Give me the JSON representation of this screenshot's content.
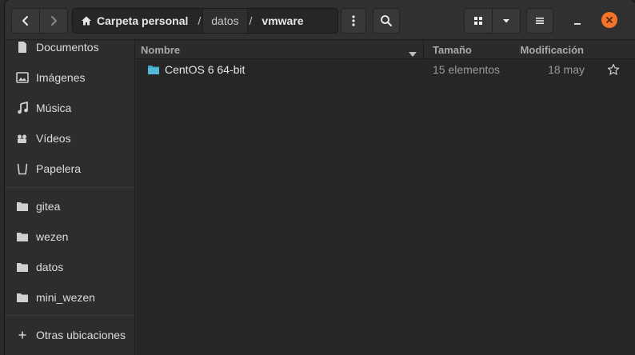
{
  "pathbar": {
    "crumbs": [
      "Carpeta personal",
      "datos",
      "vmware"
    ],
    "separator": "/"
  },
  "sidebar": {
    "places": [
      {
        "label": "Documentos",
        "icon": "document-icon"
      },
      {
        "label": "Imágenes",
        "icon": "image-icon"
      },
      {
        "label": "Música",
        "icon": "music-icon"
      },
      {
        "label": "Vídeos",
        "icon": "video-icon"
      },
      {
        "label": "Papelera",
        "icon": "trash-icon"
      }
    ],
    "bookmarks": [
      {
        "label": "gitea",
        "icon": "folder-icon"
      },
      {
        "label": "wezen",
        "icon": "folder-icon"
      },
      {
        "label": "datos",
        "icon": "folder-icon"
      },
      {
        "label": "mini_wezen",
        "icon": "folder-icon"
      }
    ],
    "other": {
      "label": "Otras ubicaciones",
      "icon": "plus-icon"
    }
  },
  "columns": {
    "name": "Nombre",
    "size": "Tamaño",
    "modified": "Modificación"
  },
  "files": [
    {
      "name": "CentOS 6 64-bit",
      "size": "15 elementos",
      "modified": "18 may",
      "icon": "folder-icon",
      "starred": false
    }
  ],
  "colors": {
    "accent_close": "#f37329",
    "folder": "#3fa9c9"
  }
}
